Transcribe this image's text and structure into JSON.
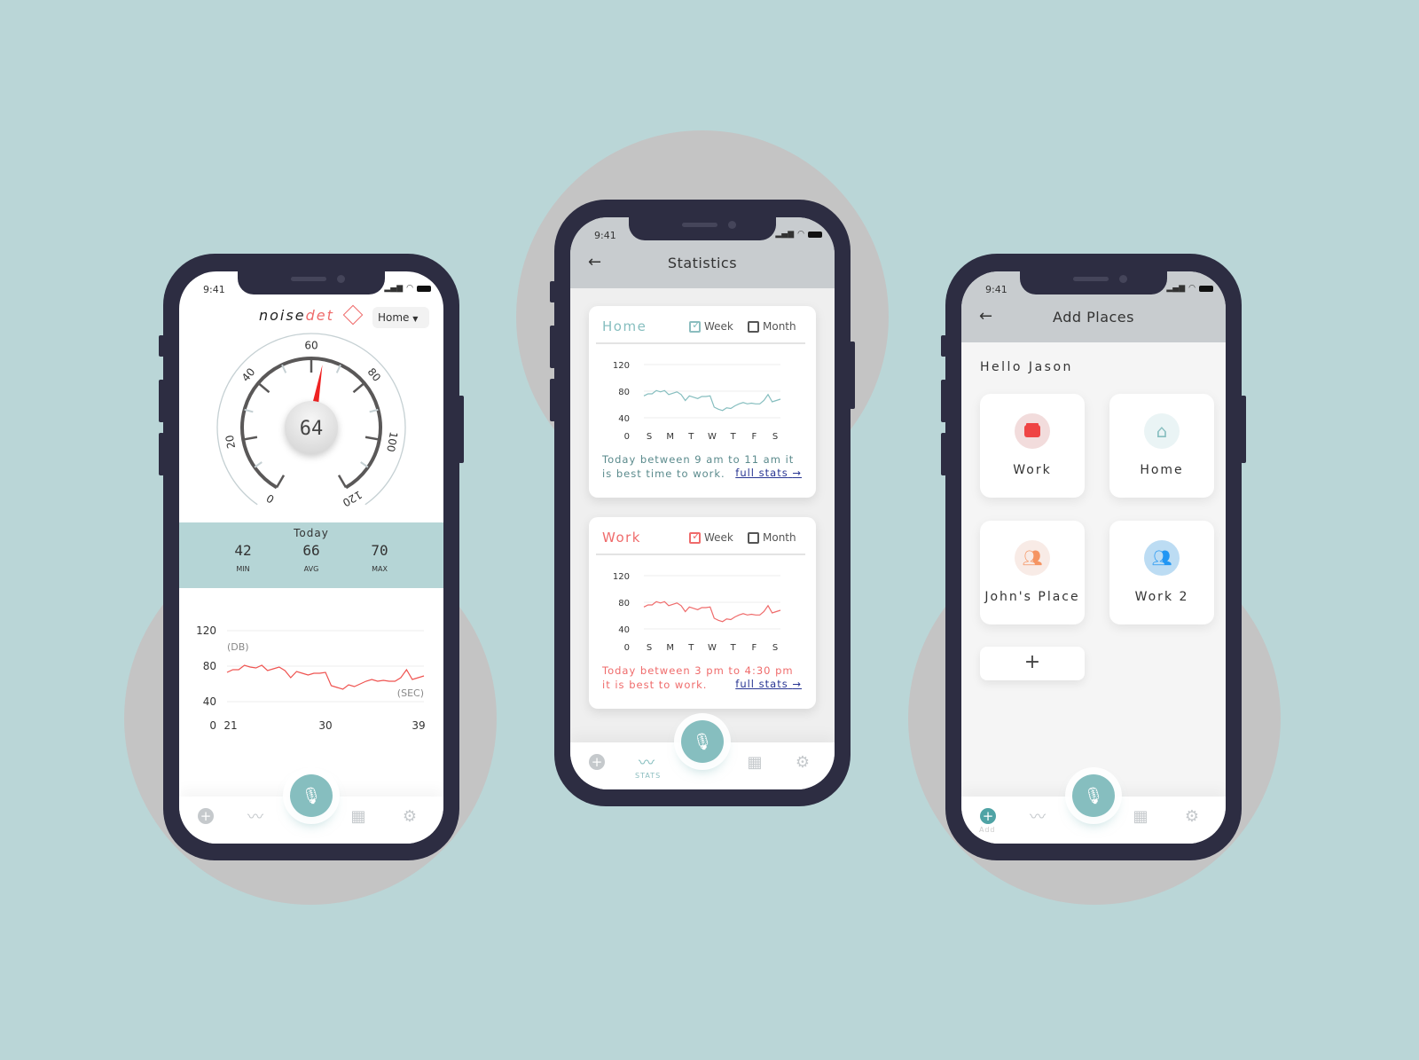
{
  "colors": {
    "background": "#bad6d7",
    "frame": "#2d2d42",
    "accent": "#86bebf",
    "red": "#ef5350",
    "header": "#c8cccf"
  },
  "status": {
    "time": "9:41"
  },
  "meter": {
    "logo": {
      "part1": "noise",
      "part2": "det"
    },
    "location_select": "Home",
    "gauge": {
      "value": 64,
      "min": 0,
      "max": 120,
      "ticks": [
        "0",
        "20",
        "40",
        "60",
        "80",
        "100",
        "120"
      ]
    },
    "today": {
      "label": "Today",
      "min": {
        "value": "42",
        "label": "MIN"
      },
      "avg": {
        "value": "66",
        "label": "AVG"
      },
      "max": {
        "value": "70",
        "label": "MAX"
      }
    },
    "chart_data": {
      "type": "line",
      "ylabel": "(DB)",
      "xlabel": "(SEC)",
      "yticks": [
        "120",
        "80",
        "40",
        "0"
      ],
      "ylim": [
        0,
        120
      ],
      "xticks": [
        "21",
        "30",
        "39"
      ],
      "xlim": [
        21,
        39
      ],
      "values": [
        73,
        76,
        76,
        81,
        79,
        78,
        81,
        75,
        77,
        79,
        75,
        67,
        74,
        72,
        70,
        72,
        72,
        73,
        58,
        56,
        54,
        59,
        57,
        60,
        63,
        65,
        63,
        64,
        63,
        63,
        67,
        76,
        65,
        67,
        69
      ]
    }
  },
  "stats": {
    "title": "Statistics",
    "cards": [
      {
        "title": "Home",
        "week": "Week",
        "month": "Month",
        "week_checked": true,
        "month_checked": false,
        "color": "#86bebf",
        "note": "Today between 9 am to 11 am it is best time to work.",
        "link": "full stats",
        "chart_data": {
          "type": "line",
          "yticks": [
            "120",
            "80",
            "40",
            "0"
          ],
          "ylim": [
            0,
            120
          ],
          "xticks": [
            "S",
            "M",
            "T",
            "W",
            "T",
            "F",
            "S"
          ],
          "values": [
            73,
            76,
            76,
            81,
            79,
            81,
            75,
            77,
            79,
            75,
            66,
            73,
            71,
            69,
            72,
            72,
            73,
            56,
            53,
            51,
            55,
            54,
            58,
            61,
            63,
            61,
            62,
            61,
            61,
            66,
            75,
            64,
            66,
            68
          ]
        }
      },
      {
        "title": "Work",
        "week": "Week",
        "month": "Month",
        "week_checked": true,
        "month_checked": false,
        "color": "#ef6b6b",
        "note": "Today between 3 pm to 4:30 pm it is best to work.",
        "link": "full stats",
        "chart_data": {
          "type": "line",
          "yticks": [
            "120",
            "80",
            "40",
            "0"
          ],
          "ylim": [
            0,
            120
          ],
          "xticks": [
            "S",
            "M",
            "T",
            "W",
            "T",
            "F",
            "S"
          ],
          "values": [
            73,
            76,
            76,
            81,
            79,
            81,
            75,
            77,
            79,
            75,
            66,
            73,
            71,
            69,
            72,
            72,
            73,
            56,
            53,
            51,
            55,
            54,
            58,
            61,
            63,
            61,
            62,
            61,
            61,
            66,
            75,
            64,
            66,
            68
          ]
        }
      }
    ],
    "nav_active": "STATS"
  },
  "places": {
    "title": "Add Places",
    "greeting": "Hello Jason",
    "items": [
      {
        "label": "Work",
        "icon": "briefcase-icon"
      },
      {
        "label": "Home",
        "icon": "house-icon"
      },
      {
        "label": "John's Place",
        "icon": "people-icon"
      },
      {
        "label": "Work 2",
        "icon": "people-icon"
      }
    ],
    "add_label": "+",
    "nav_active": "Add"
  }
}
